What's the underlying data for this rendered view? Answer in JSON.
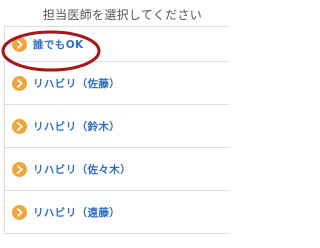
{
  "header": {
    "title": "担当医師を選択してください"
  },
  "doctor_list": {
    "items": [
      {
        "label": "誰でもOK"
      },
      {
        "label": "リハビリ（佐藤）"
      },
      {
        "label": "リハビリ（鈴木）"
      },
      {
        "label": "リハビリ（佐々木）"
      },
      {
        "label": "リハビリ（遠藤）"
      }
    ]
  },
  "colors": {
    "accent_icon": "#f0a63a",
    "label_text": "#2f6fc4",
    "highlight_ring": "#a61919"
  },
  "icons": {
    "item_icon": "chevron-right-icon"
  }
}
